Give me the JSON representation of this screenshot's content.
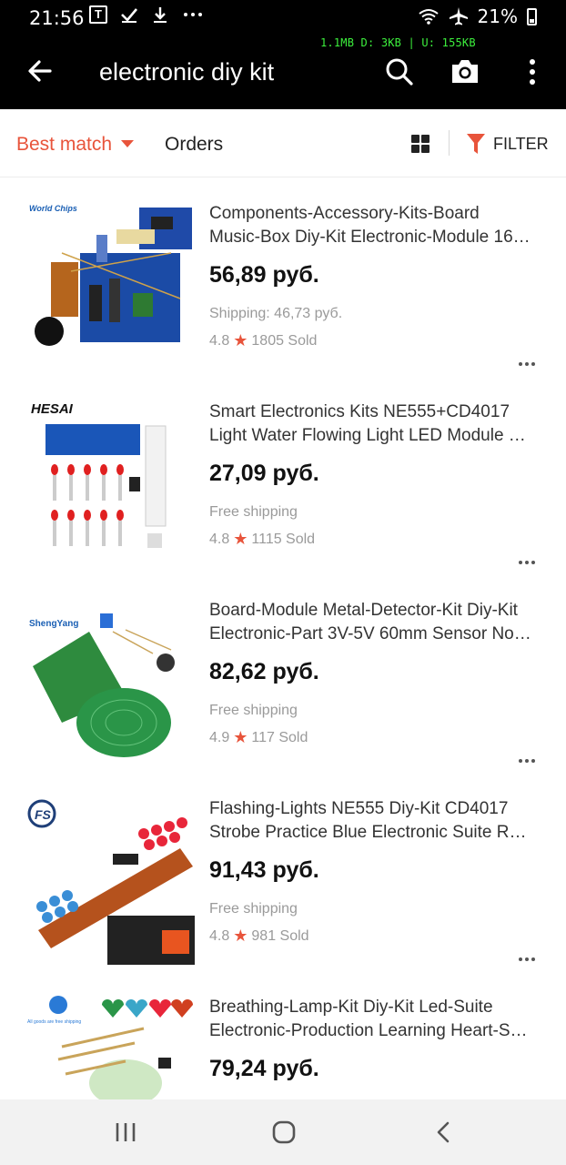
{
  "status_bar": {
    "time": "21:56",
    "battery": "21%",
    "net_speed": "1.1MB   D:  3KB   |  U: 155KB"
  },
  "header": {
    "search_query": "electronic diy kit",
    "icons": [
      "back-arrow-icon",
      "search-icon",
      "camera-icon",
      "more-vert-icon"
    ]
  },
  "sort_bar": {
    "best_match": "Best match",
    "orders": "Orders",
    "filter": "FILTER",
    "accent_color": "#e8543b"
  },
  "products": [
    {
      "brand": "World Chips",
      "title_line1": "Components-Accessory-Kits-Board",
      "title_line2": "Music-Box Diy-Kit Electronic-Module 16…",
      "price": "56,89 руб.",
      "shipping": "Shipping: 46,73 руб.",
      "rating": "4.8",
      "sold": "1805 Sold"
    },
    {
      "brand": "HESAI",
      "title_line1": "Smart Electronics Kits NE555+CD4017",
      "title_line2": "Light Water Flowing Light LED Module …",
      "price": "27,09 руб.",
      "shipping": "Free shipping",
      "rating": "4.8",
      "sold": "1115 Sold"
    },
    {
      "brand": "ShengYang",
      "title_line1": "Board-Module Metal-Detector-Kit Diy-Kit",
      "title_line2": "Electronic-Part 3V-5V 60mm Sensor No…",
      "price": "82,62 руб.",
      "shipping": "Free shipping",
      "rating": "4.9",
      "sold": "117 Sold"
    },
    {
      "brand": "FS",
      "title_line1": "Flashing-Lights NE555 Diy-Kit CD4017",
      "title_line2": "Strobe Practice Blue Electronic Suite R…",
      "price": "91,43 руб.",
      "shipping": "Free shipping",
      "rating": "4.8",
      "sold": "981 Sold"
    },
    {
      "brand": "All goods are free shipping",
      "title_line1": "Breathing-Lamp-Kit Diy-Kit Led-Suite",
      "title_line2": "Electronic-Production Learning Heart-S…",
      "price": "79,24 руб."
    }
  ]
}
